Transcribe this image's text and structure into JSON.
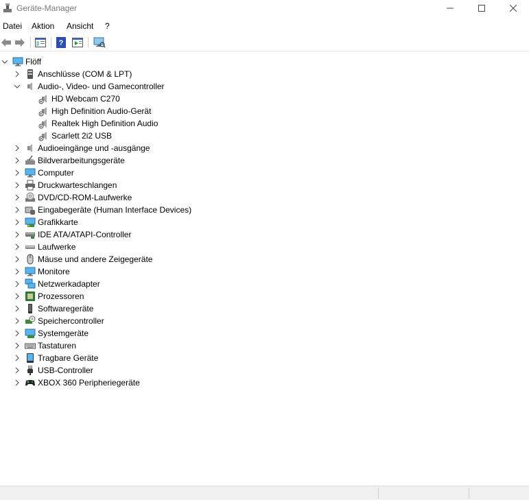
{
  "window": {
    "title": "Geräte-Manager"
  },
  "menu": [
    "Datei",
    "Aktion",
    "Ansicht",
    "?"
  ],
  "tree": {
    "root": "Flöff",
    "categories": [
      {
        "label": "Anschlüsse (COM & LPT)",
        "icon": "port-icon",
        "expanded": false
      },
      {
        "label": "Audio-, Video- und Gamecontroller",
        "icon": "speaker-icon",
        "expanded": true,
        "children": [
          "HD Webcam C270",
          "High Definition Audio-Gerät",
          "Realtek High Definition Audio",
          "Scarlett 2i2 USB"
        ]
      },
      {
        "label": "Audioeingänge und -ausgänge",
        "icon": "speaker-icon",
        "expanded": false
      },
      {
        "label": "Bildverarbeitungsgeräte",
        "icon": "imaging-icon",
        "expanded": false
      },
      {
        "label": "Computer",
        "icon": "computer-icon",
        "expanded": false
      },
      {
        "label": "Druckwarteschlangen",
        "icon": "printer-icon",
        "expanded": false
      },
      {
        "label": "DVD/CD-ROM-Laufwerke",
        "icon": "disc-icon",
        "expanded": false
      },
      {
        "label": "Eingabegeräte (Human Interface Devices)",
        "icon": "hid-icon",
        "expanded": false
      },
      {
        "label": "Grafikkarte",
        "icon": "display-adapter-icon",
        "expanded": false
      },
      {
        "label": "IDE ATA/ATAPI-Controller",
        "icon": "ide-icon",
        "expanded": false
      },
      {
        "label": "Laufwerke",
        "icon": "drive-icon",
        "expanded": false
      },
      {
        "label": "Mäuse und andere Zeigegeräte",
        "icon": "mouse-icon",
        "expanded": false
      },
      {
        "label": "Monitore",
        "icon": "monitor-icon",
        "expanded": false
      },
      {
        "label": "Netzwerkadapter",
        "icon": "network-icon",
        "expanded": false
      },
      {
        "label": "Prozessoren",
        "icon": "cpu-icon",
        "expanded": false
      },
      {
        "label": "Softwaregeräte",
        "icon": "software-device-icon",
        "expanded": false
      },
      {
        "label": "Speichercontroller",
        "icon": "storage-controller-icon",
        "expanded": false
      },
      {
        "label": "Systemgeräte",
        "icon": "system-device-icon",
        "expanded": false
      },
      {
        "label": "Tastaturen",
        "icon": "keyboard-icon",
        "expanded": false
      },
      {
        "label": "Tragbare Geräte",
        "icon": "portable-device-icon",
        "expanded": false
      },
      {
        "label": "USB-Controller",
        "icon": "usb-icon",
        "expanded": false
      },
      {
        "label": "XBOX 360 Peripheriegeräte",
        "icon": "gamepad-icon",
        "expanded": false
      }
    ]
  }
}
